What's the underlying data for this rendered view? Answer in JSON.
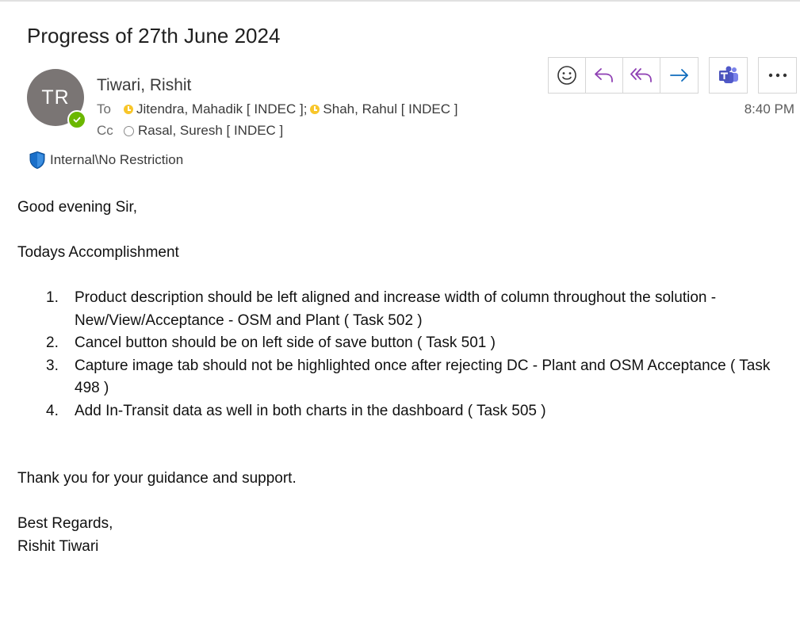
{
  "email": {
    "subject": "Progress of 27th June 2024",
    "sender": {
      "initials": "TR",
      "name": "Tiwari, Rishit",
      "presence": "available",
      "presence_color": "#6bb700",
      "avatar_color": "#7a7574"
    },
    "to_label": "To",
    "to": [
      {
        "name": "Jitendra, Mahadik [ INDEC ];",
        "status": "away"
      },
      {
        "name": "Shah, Rahul [ INDEC ]",
        "status": "away"
      }
    ],
    "cc_label": "Cc",
    "cc": [
      {
        "name": "Rasal, Suresh [ INDEC ]",
        "status": "offline"
      }
    ],
    "time": "8:40 PM",
    "sensitivity_label": "Internal\\No Restriction"
  },
  "toolbar": {
    "buttons": [
      {
        "icon": "emoji-icon",
        "name": "react-button"
      },
      {
        "icon": "reply-icon",
        "name": "reply-button"
      },
      {
        "icon": "reply-all-icon",
        "name": "reply-all-button"
      },
      {
        "icon": "forward-icon",
        "name": "forward-button"
      },
      {
        "icon": "teams-icon",
        "name": "teams-chat-button"
      },
      {
        "icon": "more-icon",
        "name": "more-actions-button"
      }
    ],
    "accent_color": "#0f6cbd",
    "reply_color": "#8e3fb3"
  },
  "body": {
    "greeting": "Good evening Sir,",
    "heading": "Todays Accomplishment",
    "tasks": [
      {
        "num": "1.",
        "text": "Product description should be left aligned and increase width of column throughout the solution - New/View/Acceptance - OSM and Plant ( Task 502 )"
      },
      {
        "num": "2.",
        "text": "Cancel button should be on left side of save button ( Task 501 )"
      },
      {
        "num": "3.",
        "text": "Capture image tab should not be highlighted once after rejecting DC - Plant and OSM Acceptance ( Task 498 )"
      },
      {
        "num": "4.",
        "text": "Add In-Transit data as well in both charts in the dashboard ( Task 505 )"
      }
    ],
    "thanks": "Thank you for your guidance and support.",
    "signoff": "Best Regards,",
    "signature": "Rishit Tiwari"
  }
}
